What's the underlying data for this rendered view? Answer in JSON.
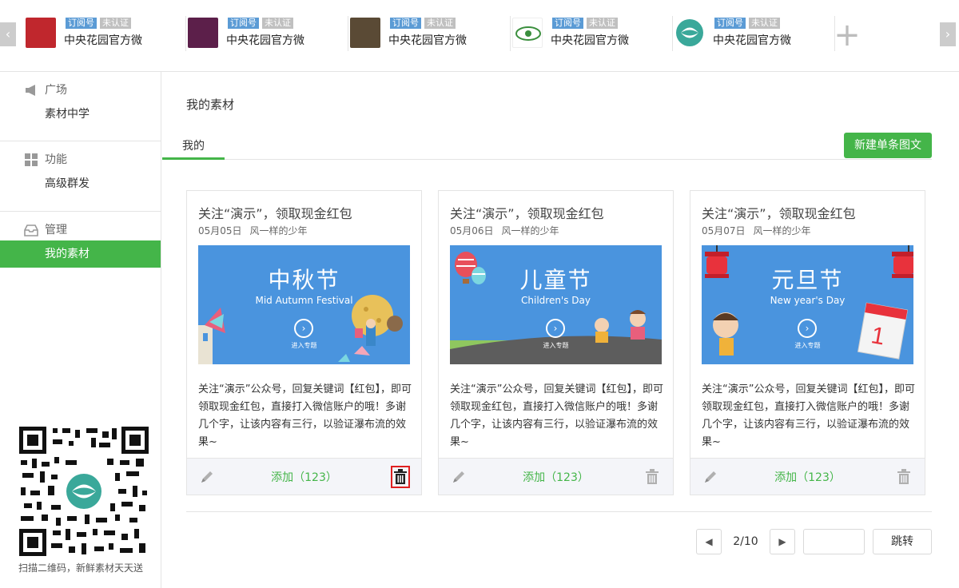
{
  "accounts": {
    "items": [
      {
        "name": "中央花园官方微",
        "tag_type": "订阅号",
        "tag_verify": "未认证",
        "logo_color": "#c0272d"
      },
      {
        "name": "中央花园官方微",
        "tag_type": "订阅号",
        "tag_verify": "未认证",
        "logo_color": "#5c1f4a"
      },
      {
        "name": "中央花园官方微",
        "tag_type": "订阅号",
        "tag_verify": "未认证",
        "logo_color": "#5a4a35"
      },
      {
        "name": "中央花园官方微",
        "tag_type": "订阅号",
        "tag_verify": "未认证",
        "logo_color": "#3b8f3e"
      },
      {
        "name": "中央花园官方微",
        "tag_type": "订阅号",
        "tag_verify": "未认证",
        "logo_color": "#3aa89a"
      }
    ],
    "prev_icon": "chevron-left-icon",
    "next_icon": "chevron-right-icon",
    "add_icon": "plus-icon",
    "prev_glyph": "‹",
    "next_glyph": "›",
    "add_glyph": "+"
  },
  "sidebar": {
    "groups": [
      {
        "title": "广场",
        "icon": "megaphone-icon",
        "items": [
          {
            "label": "素材中学"
          }
        ]
      },
      {
        "title": "功能",
        "icon": "grid-icon",
        "items": [
          {
            "label": "高级群发"
          }
        ]
      },
      {
        "title": "管理",
        "icon": "inbox-icon",
        "items": [
          {
            "label": "我的素材",
            "active": true
          }
        ]
      }
    ],
    "qr_caption": "扫描二维码，新鲜素材天天送"
  },
  "main": {
    "title": "我的素材",
    "tabs": [
      {
        "label": "我的",
        "active": true
      }
    ],
    "new_button": "新建单条图文",
    "cards": [
      {
        "title": "关注“演示”，领取现金红包",
        "date": "05月05日",
        "author": "风一样的少年",
        "cover_title": "中秋节",
        "cover_subtitle": "Mid Autumn Festival",
        "cover_enter": "进入专题",
        "cover_go_glyph": "›",
        "description": "关注“演示”公众号，回复关键词【红包】，即可领取现金红包，直接打入微信账户的哦！多谢几个字，让该内容有三行，以验证瀑布流的效果~",
        "add_label": "添加（123）",
        "delete_highlighted": true
      },
      {
        "title": "关注“演示”，领取现金红包",
        "date": "05月06日",
        "author": "风一样的少年",
        "cover_title": "儿童节",
        "cover_subtitle": "Children's Day",
        "cover_enter": "进入专题",
        "cover_go_glyph": "›",
        "description": "关注“演示”公众号，回复关键词【红包】，即可领取现金红包，直接打入微信账户的哦！多谢几个字，让该内容有三行，以验证瀑布流的效果~",
        "add_label": "添加（123）",
        "delete_highlighted": false
      },
      {
        "title": "关注“演示”，领取现金红包",
        "date": "05月07日",
        "author": "风一样的少年",
        "cover_title": "元旦节",
        "cover_subtitle": "New year's Day",
        "cover_enter": "进入专题",
        "cover_go_glyph": "›",
        "description": "关注“演示”公众号，回复关键词【红包】，即可领取现金红包，直接打入微信账户的哦！多谢几个字，让该内容有三行，以验证瀑布流的效果~",
        "add_label": "添加（123）",
        "delete_highlighted": false
      }
    ],
    "pager": {
      "current": "2/10",
      "go_label": "跳转",
      "input_value": "",
      "prev_glyph": "◀",
      "next_glyph": "▶"
    }
  },
  "colors": {
    "accent": "#44b549",
    "cover_bg": "#4a94de",
    "highlight": "#e02020"
  }
}
